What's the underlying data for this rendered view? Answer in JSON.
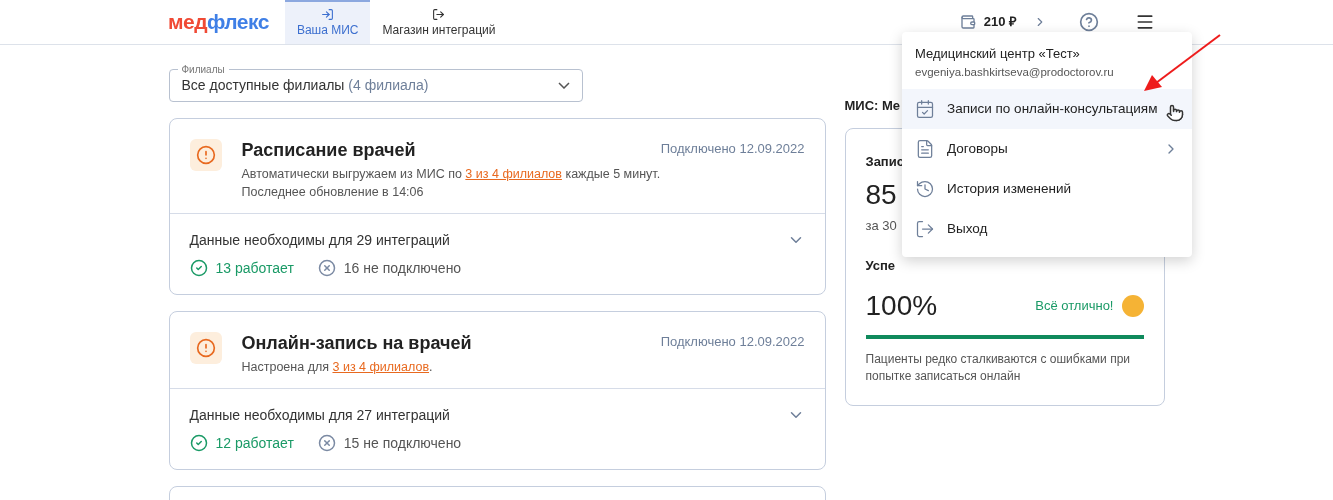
{
  "logo": {
    "part_1": "мед",
    "part_2": "флекс"
  },
  "tabs": [
    {
      "label": "Ваша МИС",
      "kind": "enter",
      "selected": true
    },
    {
      "label": "Магазин интеграций",
      "kind": "exit",
      "selected": false
    }
  ],
  "balance": "210 ₽",
  "filter": {
    "label": "Филиалы",
    "value": "Все доступные филиалы",
    "count": "(4 филиала)"
  },
  "cards": [
    {
      "title": "Расписание врачей",
      "connected": "Подключено 12.09.2022",
      "before": "Автоматически выгружаем из МИС по ",
      "link": "3 из 4 филиалов",
      "after": " каждые 5 минут.",
      "note": "Последнее обновление в 14:06",
      "needs": "Данные необходимы для 29 интеграций",
      "expanded": false,
      "working": "13 работает",
      "not_connected": "16 не подключено"
    },
    {
      "title": "Онлайн-запись на врачей",
      "connected": "Подключено 12.09.2022",
      "before": "Настроена для ",
      "link": "3 из 4 филиалов",
      "after": ".",
      "needs": "Данные необходимы для 27 интеграций",
      "expanded": false,
      "working": "12 работает",
      "not_connected": "15 не подключено"
    }
  ],
  "side": {
    "heading": "МИС: Ме",
    "title": "Запис",
    "count": "85",
    "period": "за 30",
    "success_title": "Успе",
    "percent": "100%",
    "status": "Всё отлично!",
    "level": 1,
    "note": "Пациенты редко сталкиваются с ошибками при попытке записаться онлайн"
  },
  "menu": {
    "org": "Медицинский центр «Тест»",
    "email": "evgeniya.bashkirtseva@prodoctorov.ru",
    "items": [
      {
        "label": "Записи по онлайн-консультациям",
        "kind": "calendar",
        "submenu": false,
        "selected": true
      },
      {
        "label": "Договоры",
        "kind": "document",
        "submenu": true,
        "selected": false
      },
      {
        "label": "История изменений",
        "kind": "history",
        "submenu": false,
        "selected": false
      },
      {
        "label": "Выход",
        "kind": "logout",
        "submenu": false,
        "selected": false
      }
    ]
  }
}
